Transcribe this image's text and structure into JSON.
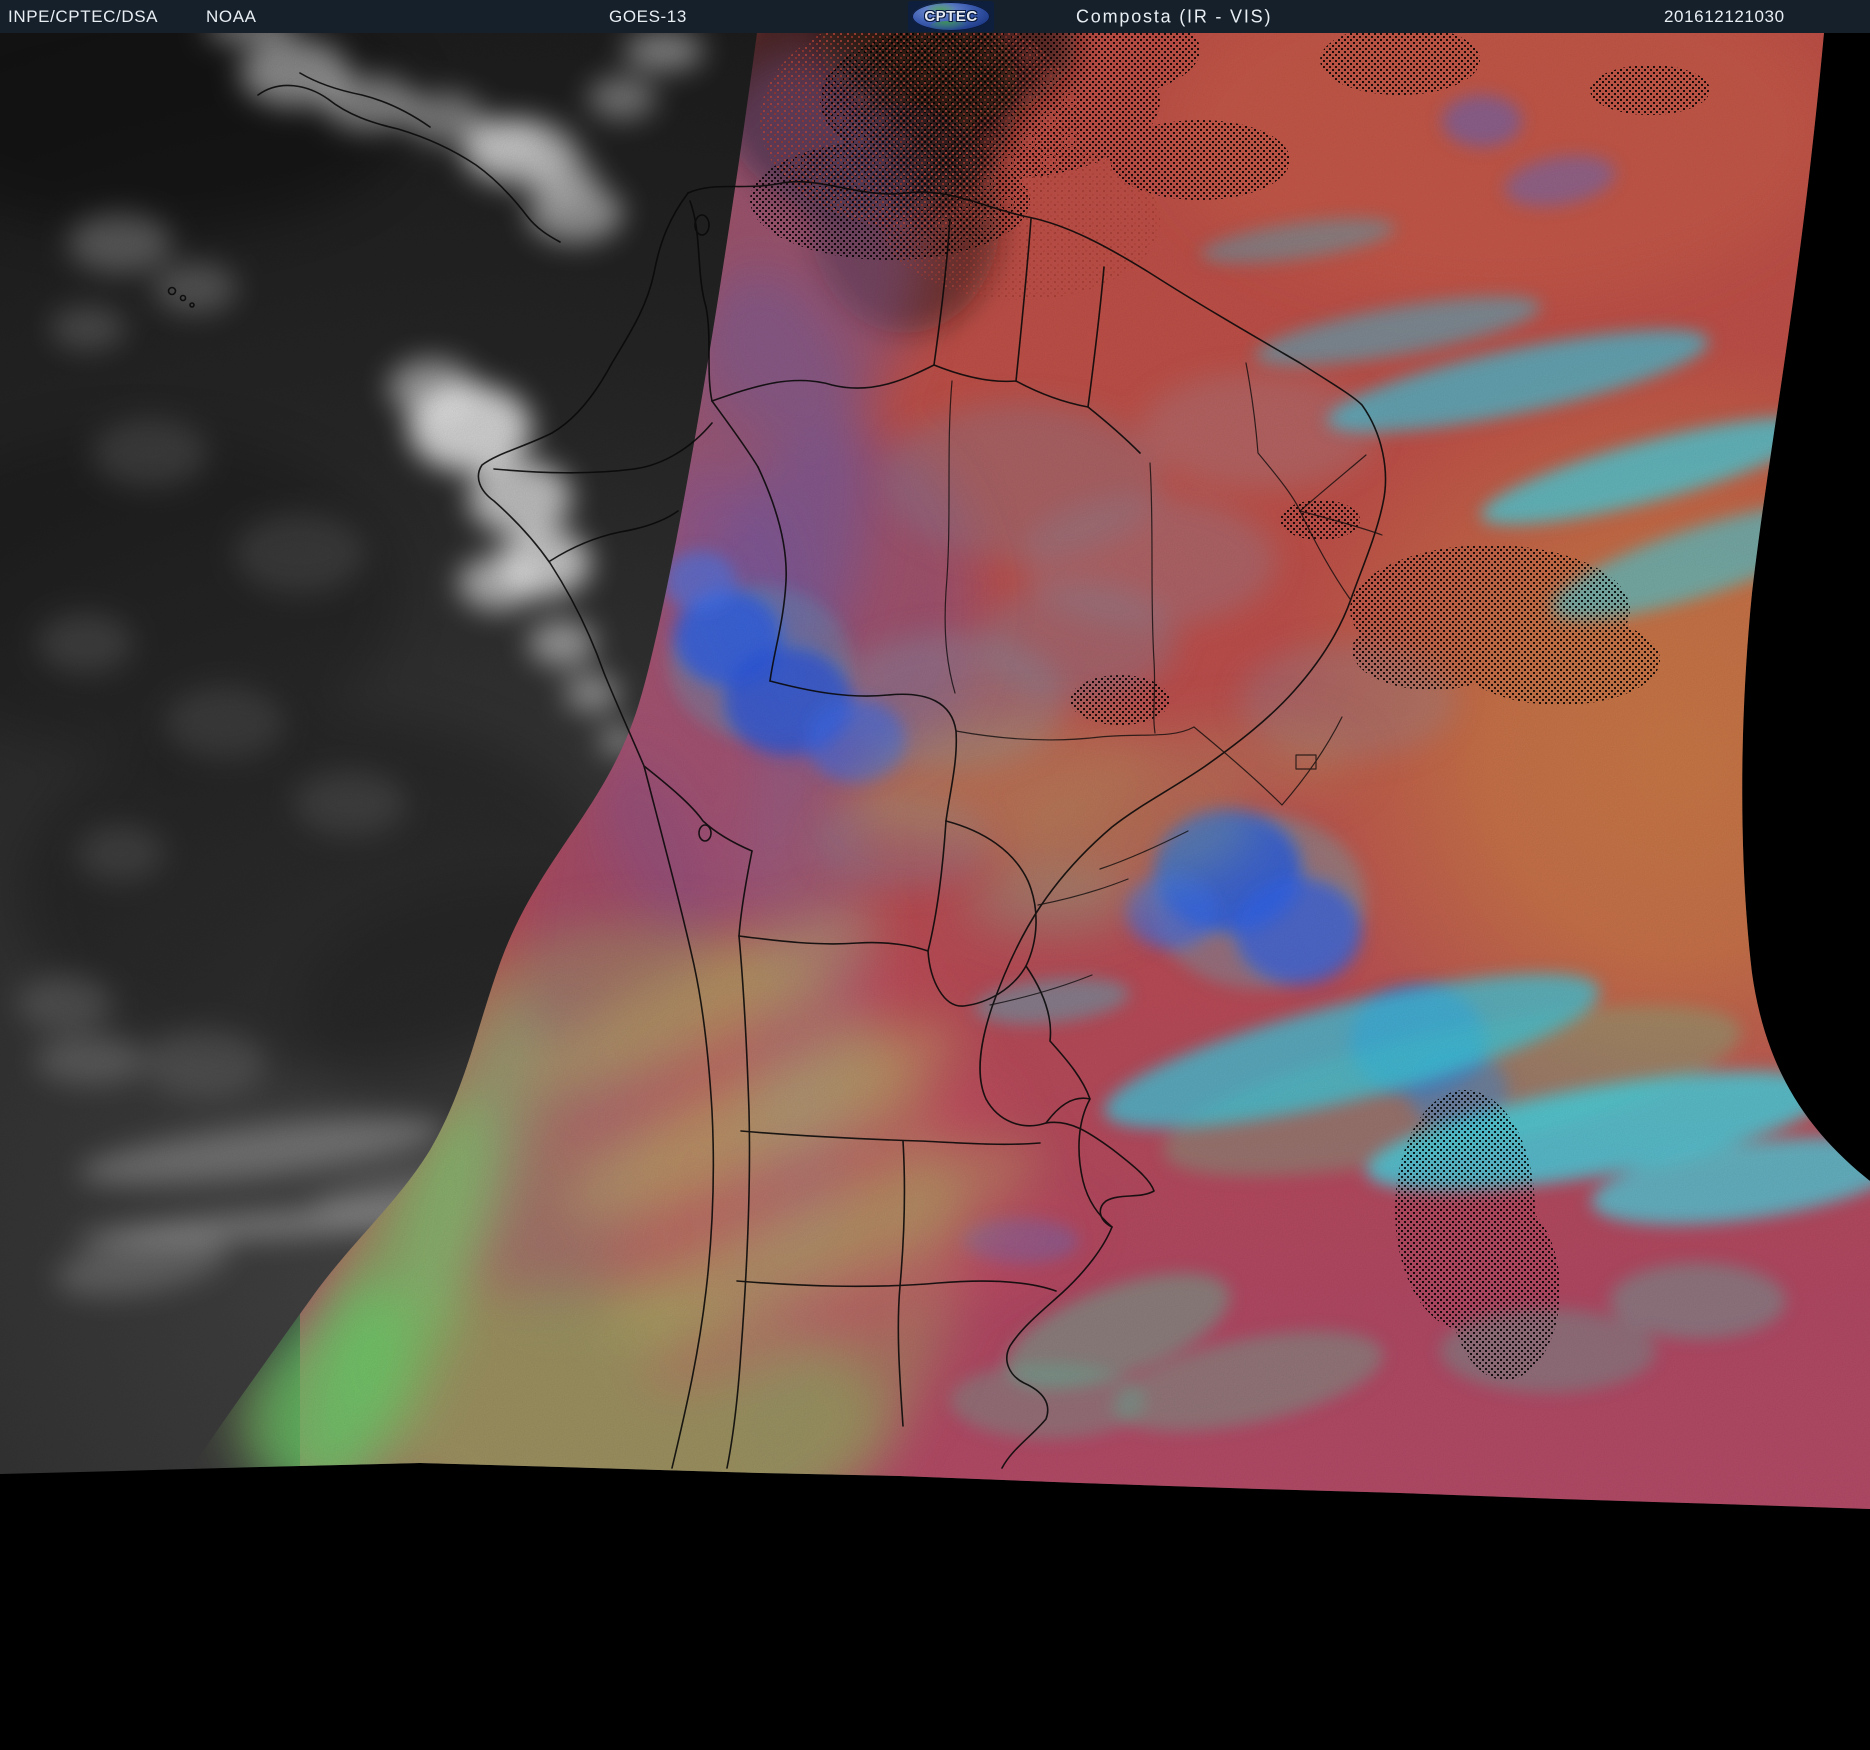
{
  "header": {
    "agency": "INPE/CPTEC/DSA",
    "noaa": "NOAA",
    "satellite": "GOES-13",
    "product": "Composta (IR - VIS)",
    "timestamp": "201612121030",
    "logo_text": "CPTEC"
  },
  "palette": {
    "header_bg": "#15202b",
    "header_text": "#e9eef3",
    "space_black": "#000000",
    "vis_ocean_dark": "#262626",
    "vis_ocean_light": "#484848",
    "vis_cloud_white": "#ffffff",
    "ir_warm_red": "#c25148",
    "ir_salmon": "#cd5f4a",
    "ir_orange": "#cd7c47",
    "ir_magenta": "#b54a66",
    "ir_purple": "#7f5a9a",
    "ir_cold_blue": "#2e5fe6",
    "ir_cyan": "#3fd2e8",
    "ir_green": "#66d96e",
    "ir_khaki": "#b9c46a",
    "ir_slate_cloud": "#8593a8",
    "border_line": "#0b0b0b",
    "logo_blue": "#3c5cb0",
    "logo_green": "#3f9b4e"
  }
}
